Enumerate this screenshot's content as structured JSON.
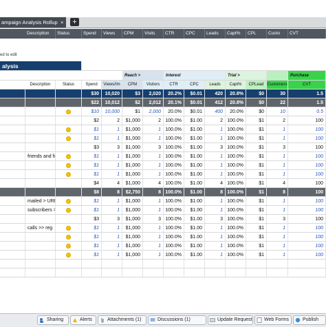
{
  "sheet_tab": {
    "title": "ampaign Analysis Rollup",
    "close": "×",
    "add": "+"
  },
  "columns": [
    "Description",
    "Status",
    "Spend",
    "Views",
    "CPM",
    "Visits",
    "CTR",
    "CPC",
    "Leads",
    "Capt%",
    "CPL",
    "Custo",
    "CVT"
  ],
  "edit_hint": "ed to edit",
  "colors": {
    "header_blue": "#163f6e",
    "summary_dark": "#5f656b",
    "reach": "#d6e3ee",
    "interest": "#dfeef6",
    "trial": "#dcf3df",
    "purchase_bright": "#38d34b",
    "purchase_light": "#baf0c0",
    "status_dot": "#f2c300",
    "link_blue": "#2a55b8"
  },
  "banner": {
    "title": "alysis",
    "groups": [
      {
        "key": "reach",
        "label": "Reach >"
      },
      {
        "key": "interest",
        "label": "Interest"
      },
      {
        "key": "trial",
        "label": "Trial >"
      },
      {
        "key": "purchase",
        "label": "Purchase"
      }
    ],
    "subheaders": [
      "Description",
      "Status",
      "Spend",
      "Views/Im",
      "CPM",
      "Visitors",
      "CTR",
      "CPC",
      "Leads",
      "Capt%",
      "CPLead",
      "Customers",
      "CVT"
    ]
  },
  "rows": [
    {
      "type": "total",
      "cells": [
        "",
        "",
        "$30",
        "10,020",
        "$3",
        "2,020",
        "20.2%",
        "$0.01",
        "420",
        "20.8%",
        "$0",
        "30",
        "1.5"
      ]
    },
    {
      "type": "sub",
      "cells": [
        "",
        "",
        "$22",
        "10,012",
        "$2",
        "2,012",
        "20.1%",
        "$0.01",
        "412",
        "20.8%",
        "$0",
        "22",
        "1.5"
      ]
    },
    {
      "type": "italic",
      "cells": [
        "",
        "dot",
        "$10",
        "10,000",
        "$1",
        "2,000",
        "20.0%",
        "$0.01",
        "400",
        "20.0%",
        "$0",
        "10",
        "0.5"
      ]
    },
    {
      "type": "plain",
      "cells": [
        "",
        "",
        "$2",
        "2",
        "$1,000",
        "2",
        "100.0%",
        "$1.00",
        "2",
        "100.0%",
        "$1",
        "2",
        "100"
      ]
    },
    {
      "type": "italic",
      "cells": [
        "",
        "dot",
        "$1",
        "1",
        "$1,000",
        "1",
        "100.0%",
        "$1.00",
        "1",
        "100.0%",
        "$1",
        "1",
        "100"
      ]
    },
    {
      "type": "italic",
      "cells": [
        "",
        "dot",
        "$1",
        "1",
        "$1,000",
        "1",
        "100.0%",
        "$1.00",
        "1",
        "100.0%",
        "$1",
        "1",
        "100"
      ]
    },
    {
      "type": "plain",
      "cells": [
        "",
        "",
        "$3",
        "3",
        "$1,000",
        "3",
        "100.0%",
        "$1.00",
        "3",
        "100.0%",
        "$1",
        "3",
        "100"
      ]
    },
    {
      "type": "italic",
      "cells": [
        "friends and followers",
        "dot",
        "$1",
        "1",
        "$1,000",
        "1",
        "100.0%",
        "$1.00",
        "1",
        "100.0%",
        "$1",
        "1",
        "100"
      ]
    },
    {
      "type": "italic",
      "cells": [
        "",
        "dot",
        "$1",
        "1",
        "$1,000",
        "1",
        "100.0%",
        "$1.00",
        "1",
        "100.0%",
        "$1",
        "1",
        "100"
      ]
    },
    {
      "type": "italic",
      "cells": [
        "",
        "dot",
        "$1",
        "1",
        "$1,000",
        "1",
        "100.0%",
        "$1.00",
        "1",
        "100.0%",
        "$1",
        "1",
        "100"
      ]
    },
    {
      "type": "plain",
      "cells": [
        "",
        "",
        "$4",
        "4",
        "$1,000",
        "4",
        "100.0%",
        "$1.00",
        "4",
        "100.0%",
        "$1",
        "4",
        "100"
      ]
    },
    {
      "type": "sub",
      "cells": [
        "",
        "",
        "$8",
        "8",
        "$2,750",
        "8",
        "100.0%",
        "$1.00",
        "8",
        "100.0%",
        "$1",
        "8",
        "100"
      ]
    },
    {
      "type": "italic",
      "cells": [
        "mailed > URL",
        "dot",
        "$1",
        "1",
        "$1,000",
        "1",
        "100.0%",
        "$1.00",
        "1",
        "100.0%",
        "$1",
        "1",
        "100"
      ]
    },
    {
      "type": "italic",
      "cells": [
        "subscribers > URL",
        "dot",
        "$1",
        "1",
        "$1,000",
        "1",
        "100.0%",
        "$1.00",
        "1",
        "100.0%",
        "$1",
        "1",
        "100"
      ]
    },
    {
      "type": "plain",
      "cells": [
        "",
        "",
        "$3",
        "3",
        "$1,000",
        "3",
        "100.0%",
        "$1.00",
        "3",
        "100.0%",
        "$1",
        "3",
        "100"
      ]
    },
    {
      "type": "italic",
      "cells": [
        "calls >> reg",
        "dot",
        "$1",
        "1",
        "$1,000",
        "1",
        "100.0%",
        "$1.00",
        "1",
        "100.0%",
        "$1",
        "1",
        "100"
      ]
    },
    {
      "type": "italic",
      "cells": [
        "",
        "dot",
        "$1",
        "1",
        "$1,000",
        "1",
        "100.0%",
        "$1.00",
        "1",
        "100.0%",
        "$1",
        "1",
        "100"
      ]
    },
    {
      "type": "italic",
      "cells": [
        "",
        "dot",
        "$1",
        "1",
        "$1,000",
        "1",
        "100.0%",
        "$1.00",
        "1",
        "100.0%",
        "$1",
        "1",
        "100"
      ]
    },
    {
      "type": "italic",
      "cells": [
        "",
        "dot",
        "$1",
        "1",
        "$1,000",
        "1",
        "100.0%",
        "$1.00",
        "1",
        "100.0%",
        "$1",
        "1",
        "100"
      ]
    },
    {
      "type": "empty",
      "cells": [
        "",
        "",
        "",
        "",
        "",
        "",
        "",
        "",
        "",
        "",
        "",
        "",
        ""
      ]
    },
    {
      "type": "empty",
      "cells": [
        "",
        "",
        "",
        "",
        "",
        "",
        "",
        "",
        "",
        "",
        "",
        "",
        ""
      ]
    }
  ],
  "bottom_tabs": [
    {
      "label": "Sharing",
      "icon": "sharing-icon"
    },
    {
      "label": "Alerts",
      "icon": "alert-bell-icon"
    },
    {
      "label": "Attachments (1)",
      "icon": "paperclip-icon"
    },
    {
      "label": "Discussions (1)",
      "icon": "discussion-icon"
    },
    {
      "label": "Update Requests",
      "icon": "update-request-icon"
    },
    {
      "label": "Web Forms",
      "icon": "web-form-icon"
    },
    {
      "label": "Publish",
      "icon": "publish-icon"
    }
  ]
}
